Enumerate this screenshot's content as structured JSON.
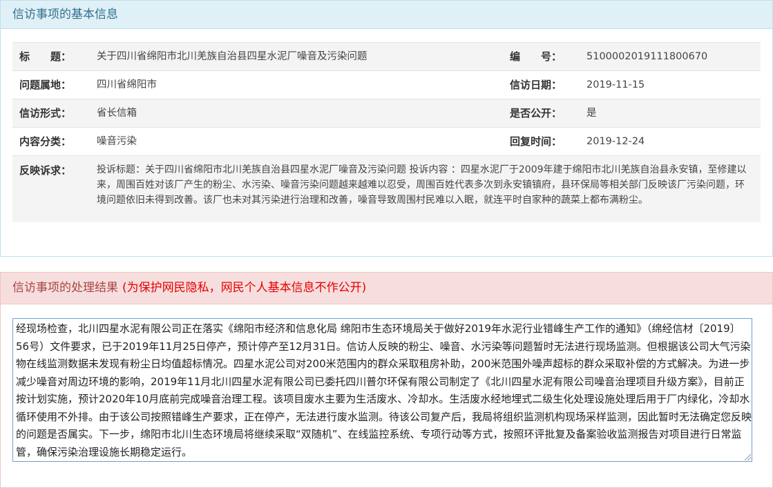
{
  "basic_info": {
    "section_title": "信访事项的基本信息",
    "title_label": "标　　题：",
    "title_value": "关于四川省绵阳市北川羌族自治县四星水泥厂噪音及污染问题",
    "number_label": "编　　号：",
    "number_value": "5100002019111800670",
    "location_label": "问题属地：",
    "location_value": "四川省绵阳市",
    "date_label": "信访日期：",
    "date_value": "2019-11-15",
    "form_label": "信访形式：",
    "form_value": "省长信箱",
    "public_label": "是否公开：",
    "public_value": "是",
    "category_label": "内容分类：",
    "category_value": "噪音污染",
    "reply_label": "回复时间：",
    "reply_value": "2019-12-24",
    "complaint_label": "反映诉求：",
    "complaint_value": "投诉标题：关于四川省绵阳市北川羌族自治县四星水泥厂噪音及污染问题 投诉内容 ：四星水泥厂于2009年建于绵阳市北川羌族自治县永安镇，至修建以来，周围百姓对该厂产生的粉尘、水污染、噪音污染问题越来越难以忍受，周围百姓代表多次到永安镇镇府，县环保局等相关部门反映该厂污染问题，环境问题依旧未得到改善。该厂也未对其污染进行治理和改善，噪音导致周围村民难以入眠，就连平时自家种的蔬菜上都布满粉尘。"
  },
  "result": {
    "section_title": "信访事项的处理结果",
    "privacy_note": "(为保护网民隐私，网民个人基本信息不作公开)",
    "text": "经现场检查，北川四星水泥有限公司正在落实《绵阳市经济和信息化局 绵阳市生态环境局关于做好2019年水泥行业错峰生产工作的通知》（绵经信材〔2019〕56号）文件要求，已于2019年11月25日停产，预计停产至12月31日。信访人反映的粉尘、噪音、水污染等问题暂时无法进行现场监测。但根据该公司大气污染物在线监测数据未发现有粉尘日均值超标情况。四星水泥公司对200米范围内的群众采取租房补助，200米范围外噪声超标的群众采取补偿的方式解决。为进一步减少噪音对周边环境的影响，2019年11月北川四星水泥有限公司已委托四川普尔环保有限公司制定了《北川四星水泥有限公司噪音治理项目升级方案》，目前正按计划实施，预计2020年10月底前完成噪音治理工程。该项目废水主要为生活废水、冷却水。生活废水经地埋式二级生化处理设施处理后用于厂内绿化，冷却水循环使用不外排。由于该公司按照错峰生产要求，正在停产，无法进行废水监测。待该公司复产后，我局将组织监测机构现场采样监测，因此暂时无法确定您反映的问题是否属实。下一步，绵阳市北川生态环境局将继续采取“双随机”、在线监控系统、专项行动等方式，按照环评批复及备案验收监测报告对项目进行日常监管，确保污染治理设施长期稳定运行。"
  }
}
